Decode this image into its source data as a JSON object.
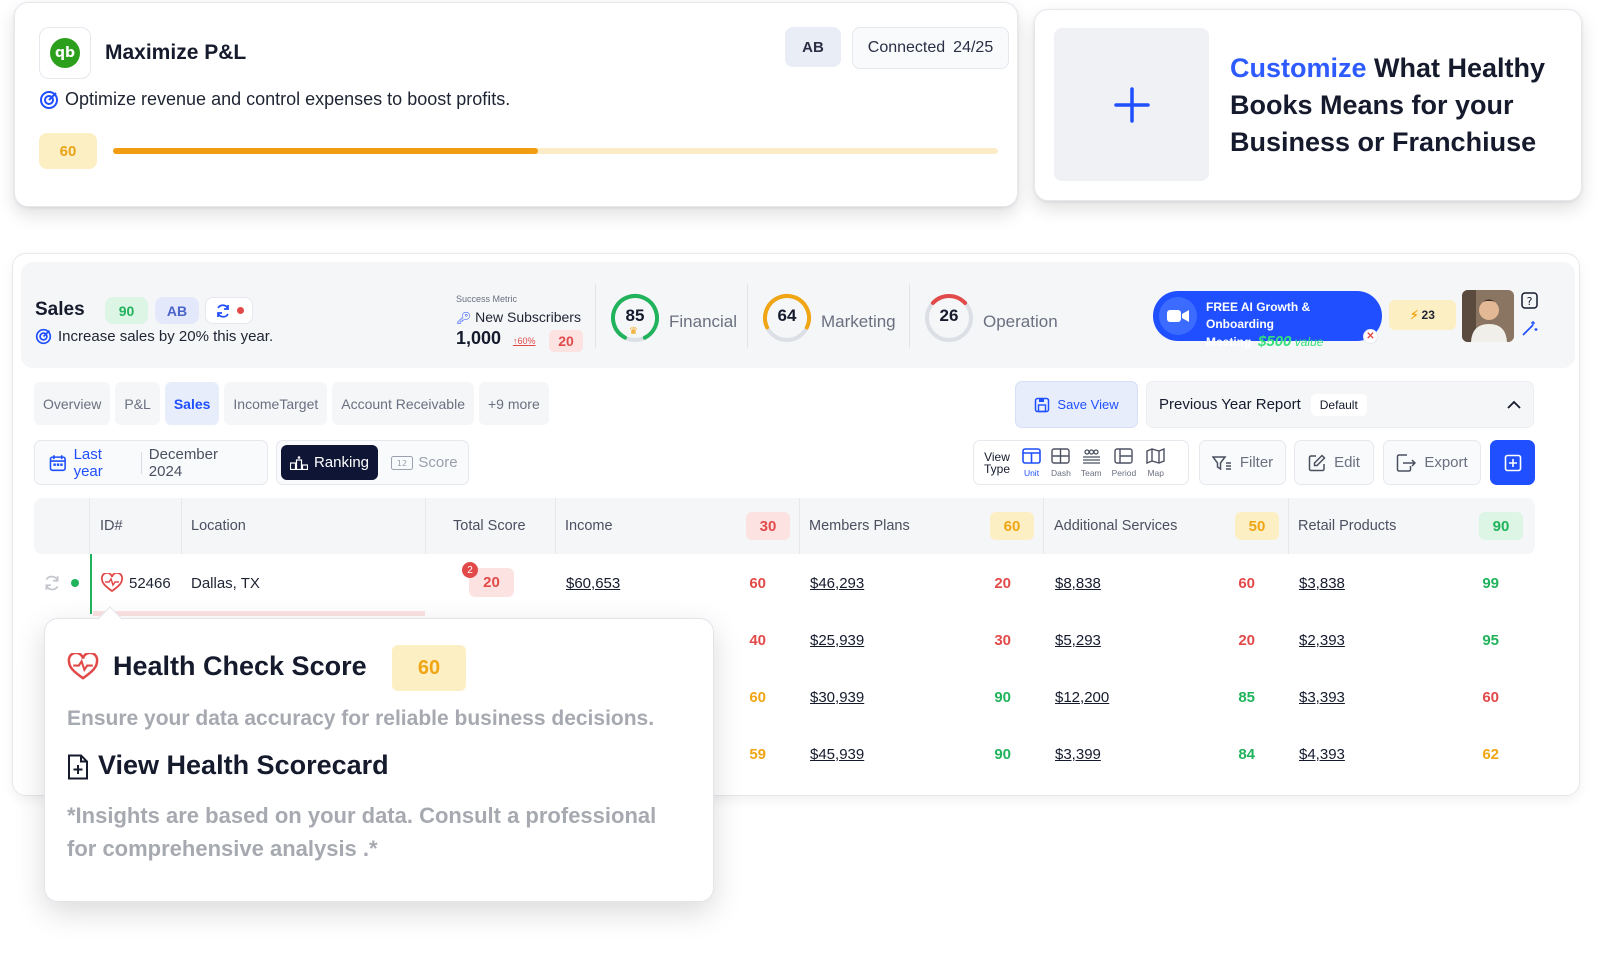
{
  "goal_card": {
    "title": "Maximize P&L",
    "logo_text": "qb",
    "owner_initials": "AB",
    "connected_label": "Connected",
    "connected_count": "24/25",
    "subtitle": "Optimize revenue and control expenses to boost profits.",
    "score": "60",
    "progress_fraction": 0.48
  },
  "customize_card": {
    "highlight": "Customize",
    "text": " What Healthy Books Means for your Business or Franchiuse"
  },
  "kpi": {
    "title": "Sales",
    "score": "90",
    "initials": "AB",
    "subtitle": "Increase sales by 20% this year.",
    "metric_label": "Success Metric",
    "metric_name": "New Subscribers",
    "metric_value": "1,000",
    "metric_change": "60%",
    "metric_badge": "20",
    "gauges": [
      {
        "value": "85",
        "label": "Financial",
        "color": "#21b35c",
        "fraction": 0.85
      },
      {
        "value": "64",
        "label": "Marketing",
        "color": "#f0a515",
        "fraction": 0.64
      },
      {
        "value": "26",
        "label": "Operation",
        "color": "#e24a4a",
        "fraction": 0.26
      }
    ],
    "promo_line1": "FREE AI Growth & Onboarding",
    "promo_line2": "Meeting",
    "promo_value": "$500",
    "promo_value_suffix": "value",
    "bolt_count": "23"
  },
  "tabs": [
    "Overview",
    "P&L",
    "Sales",
    "IncomeTarget",
    "Account Receivable",
    "+9 more"
  ],
  "active_tab": 2,
  "save_view_label": "Save View",
  "report": {
    "name": "Previous Year Report",
    "tag": "Default"
  },
  "date": {
    "period": "Last year",
    "value": "December 2024"
  },
  "segment": {
    "on": "Ranking",
    "off": "Score"
  },
  "view_type": {
    "label": "View Type",
    "items": [
      "Unit",
      "Dash",
      "Team",
      "Period",
      "Map"
    ]
  },
  "buttons": {
    "filter": "Filter",
    "edit": "Edit",
    "export": "Export"
  },
  "table": {
    "headers": {
      "id": "ID#",
      "location": "Location",
      "total": "Total Score",
      "income": "Income",
      "income_score": "30",
      "members": "Members Plans",
      "members_score": "60",
      "additional": "Additional Services",
      "additional_score": "50",
      "retail": "Retail Products",
      "retail_score": "90"
    },
    "rows": [
      {
        "id": "52466",
        "location": "Dallas, TX",
        "total": "20",
        "alert": "2",
        "income": "$60,653",
        "income_s": "60",
        "income_c": "red",
        "members": "$46,293",
        "members_s": "20",
        "members_c": "red",
        "additional": "$8,838",
        "additional_s": "60",
        "additional_c": "red",
        "retail": "$3,838",
        "retail_s": "99",
        "retail_c": "green"
      },
      {
        "income_s": "40",
        "income_c": "red",
        "members": "$25,939",
        "members_s": "30",
        "members_c": "red",
        "additional": "$5,293",
        "additional_s": "20",
        "additional_c": "red",
        "retail": "$2,393",
        "retail_s": "95",
        "retail_c": "green"
      },
      {
        "income_s": "60",
        "income_c": "orange",
        "members": "$30,939",
        "members_s": "90",
        "members_c": "green",
        "additional": "$12,200",
        "additional_s": "85",
        "additional_c": "green",
        "retail": "$3,393",
        "retail_s": "60",
        "retail_c": "red"
      },
      {
        "income_s": "59",
        "income_c": "orange",
        "members": "$45,939",
        "members_s": "90",
        "members_c": "green",
        "additional": "$3,399",
        "additional_s": "84",
        "additional_c": "green",
        "retail": "$4,393",
        "retail_s": "62",
        "retail_c": "orange"
      }
    ]
  },
  "tooltip": {
    "title": "Health Check Score",
    "score": "60",
    "text": "Ensure your data accuracy for reliable business decisions.",
    "link": "View Health Scorecard",
    "note": "*Insights are based on your data. Consult a professional for comprehensive analysis .*"
  }
}
